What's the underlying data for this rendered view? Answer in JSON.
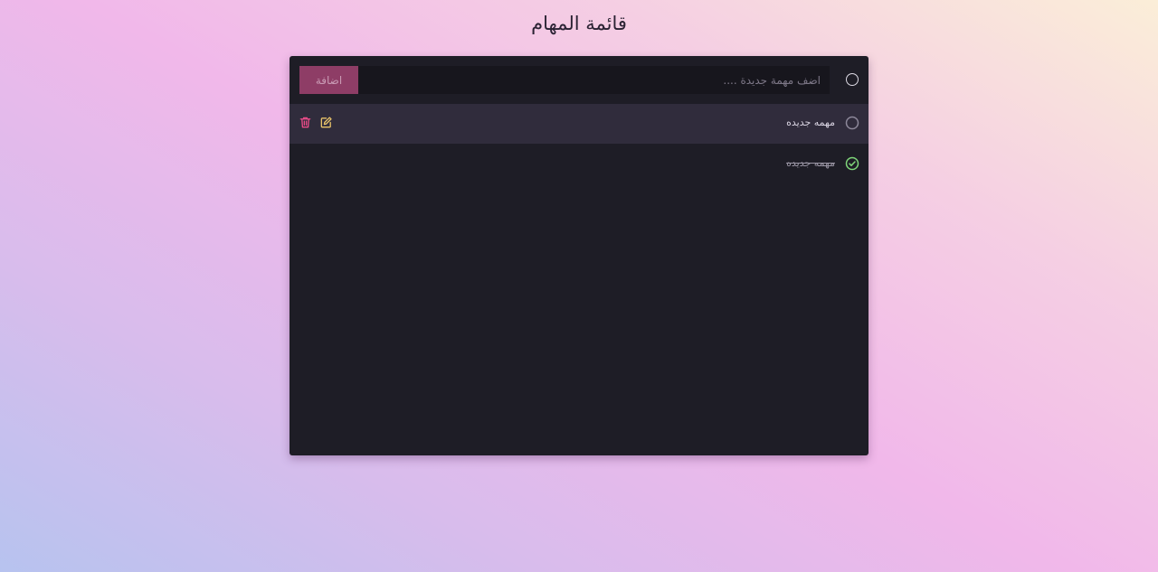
{
  "page": {
    "title": "قائمة المهام"
  },
  "new_task": {
    "placeholder": "اضف مهمة جديدة ....",
    "value": "",
    "add_label": "اضافة"
  },
  "tasks": [
    {
      "text": "مهمه جديده",
      "completed": false,
      "status_icon": "circle-icon"
    },
    {
      "text": "مهمه جديده",
      "completed": true,
      "status_icon": "check-circle-icon"
    }
  ],
  "icons": {
    "edit": "edit-icon",
    "delete": "trash-icon"
  },
  "colors": {
    "panel_bg": "#1e1d26",
    "active_row_bg": "#302c3c",
    "add_button": "#8e3d66",
    "edit_icon": "#e9c46a",
    "delete_icon": "#ea4c89",
    "check_icon": "#7fd67a"
  }
}
